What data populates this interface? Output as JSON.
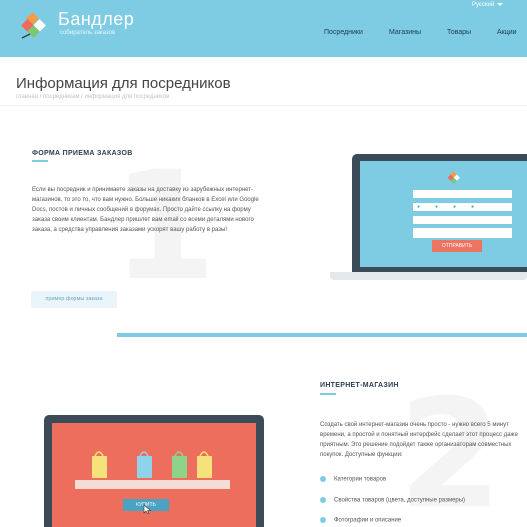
{
  "header": {
    "brand_name": "Бандлер",
    "brand_tagline": "собиратель заказов",
    "language": "Русский",
    "nav": [
      "Посредники",
      "Магазины",
      "Товары",
      "Акции"
    ]
  },
  "page": {
    "title": "Информация для посредников",
    "breadcrumb": "главная / посредникам / информация для посредников"
  },
  "section1": {
    "number": "1",
    "heading": "ФОРМА ПРИЕМА ЗАКАЗОВ",
    "text": "Если вы посредник и принимаете заказы на доставку из зарубежных интернет-магазинов, то это то, что вам нужно. Больше никаких бланков в Excel или Google Docs, постов и личных сообщений в форумах. Просто дайте ссылку на форму заказа своим клиентам. Бандлер пришлет вам email со всеми деталями нового заказа, а средства управления заказами ускорят вашу работу в разы!",
    "button_label": "пример формы заказа",
    "form_submit_label": "ОТПРАВИТЬ"
  },
  "section2": {
    "number": "2",
    "heading": "ИНТЕРНЕТ-МАГАЗИН",
    "text": "Создать свой интернет-магазин очень просто - нужно всего 5 минут времени, а простой и понятный интерфейс сделает этот процесс даже приятным. Это решение подойдет также организаторам совместных покупок. Доступные функции:",
    "features": [
      "Категории товаров",
      "Свойства товаров (цвета, доступные размеры)",
      "Фотографии и описание"
    ],
    "buy_label": "КУПИТЬ"
  },
  "colors": {
    "accent": "#7ecbe4",
    "laptop_frame": "#3b4b58",
    "shop_screen": "#ee6e5d",
    "submit_button": "#ed7461"
  },
  "icons": {
    "logo": "diamond-logo-icon",
    "bags": [
      "yellow-bag-icon",
      "blue-bag-icon",
      "green-bag-icon",
      "yellow-bag-icon"
    ],
    "cursor": "pointer-cursor-icon"
  }
}
